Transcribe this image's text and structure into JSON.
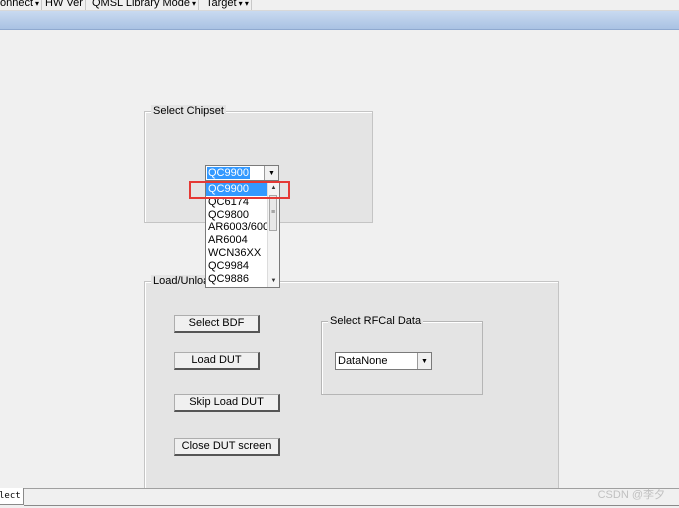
{
  "menubar": {
    "items": [
      {
        "label": "onnect",
        "arrow": "▾"
      },
      {
        "label": "HW Ver",
        "arrow": ""
      },
      {
        "label": "QMSL Library Mode",
        "arrow": "▾"
      },
      {
        "label": "Target",
        "arrow": "▾ ▾"
      }
    ]
  },
  "chipset": {
    "group_title": "Select Chipset",
    "selected": "QC9900",
    "dropdown_arrow": "▼",
    "options": [
      "QC9900",
      "QC6174",
      "QC9800",
      "AR6003/600",
      "AR6004",
      "WCN36XX",
      "QC9984",
      "QC9886"
    ],
    "scroll_up": "▲",
    "scroll_down": "▼",
    "thumb_grip": "≡"
  },
  "load": {
    "group_title": "Load/Unloa",
    "select_bdf": "Select BDF",
    "load_dut": "Load DUT",
    "skip_load_dut": "Skip Load DUT",
    "close_dut": "Close DUT screen"
  },
  "rfcal": {
    "group_title": "Select RFCal Data",
    "selected": "DataNone",
    "dropdown_arrow": "▼"
  },
  "tabs": {
    "active": "lect"
  },
  "watermark": "CSDN @李夕",
  "colors": {
    "selection": "#3399ff",
    "highlight_box": "#e53935",
    "ribbon": "#b7cdea"
  }
}
